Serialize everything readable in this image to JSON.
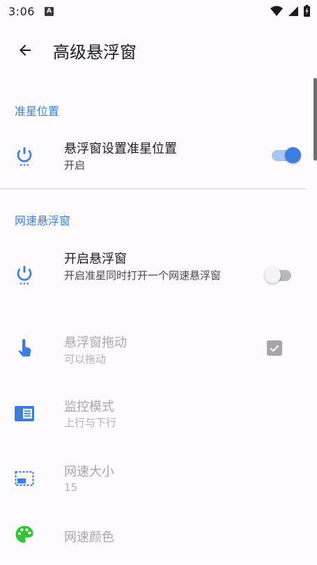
{
  "status_bar": {
    "time": "3:06",
    "notification_badge": "A"
  },
  "app_bar": {
    "title": "高级悬浮窗",
    "back_icon": "arrow-back-icon"
  },
  "sections": {
    "crosshair": {
      "header": "准星位置",
      "items": [
        {
          "title": "悬浮窗设置准星位置",
          "summary": "开启",
          "icon": "power-icon",
          "control": "switch",
          "checked": true
        }
      ]
    },
    "net_speed": {
      "header": "网速悬浮窗",
      "items": [
        {
          "title": "开启悬浮窗",
          "summary": "开启准星同时打开一个网速悬浮窗",
          "icon": "power-icon",
          "control": "switch",
          "checked": false
        },
        {
          "title": "悬浮窗拖动",
          "summary": "可以拖动",
          "icon": "touch-icon",
          "control": "checkbox",
          "checked": true,
          "enabled": false
        },
        {
          "title": "监控模式",
          "summary": "上行与下行",
          "icon": "view-list-icon",
          "enabled": false
        },
        {
          "title": "网速大小",
          "summary": "15",
          "icon": "picture-in-picture-icon",
          "enabled": false
        },
        {
          "title": "网速颜色",
          "icon": "palette-icon",
          "enabled": false
        }
      ]
    }
  },
  "colors": {
    "accent": "#3d7de0",
    "palette_icon": "#2ec52e",
    "background": "#fdfbfe"
  }
}
